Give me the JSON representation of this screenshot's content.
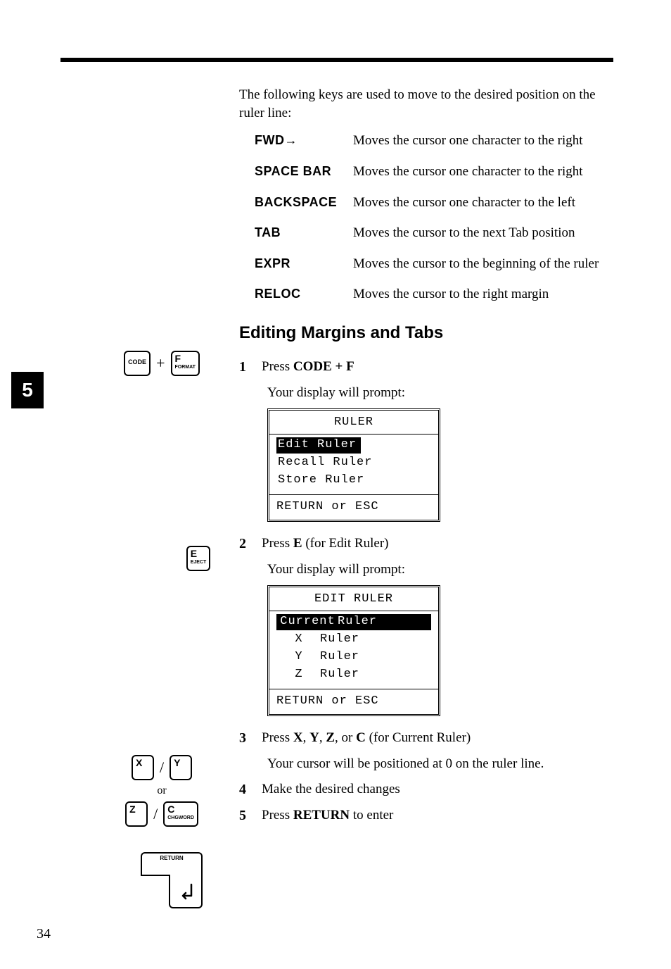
{
  "chapter_tab": "5",
  "page_number": "34",
  "intro": "The following keys are used to move to the desired position on the ruler line:",
  "keys": [
    {
      "name": "FWD→",
      "desc": "Moves the cursor one character to the right"
    },
    {
      "name": "SPACE BAR",
      "desc": "Moves the cursor one character to the right"
    },
    {
      "name": "BACKSPACE",
      "desc": "Moves the cursor one character to the left"
    },
    {
      "name": "TAB",
      "desc": "Moves the cursor to the next Tab position"
    },
    {
      "name": "EXPR",
      "desc": "Moves the cursor to the beginning of the ruler"
    },
    {
      "name": "RELOC",
      "desc": "Moves the cursor to the right margin"
    }
  ],
  "heading": "Editing Margins and Tabs",
  "step1": {
    "num": "1",
    "pre": "Press ",
    "bold": "CODE + F"
  },
  "prompt1": "Your display will prompt:",
  "screen1": {
    "title": "RULER",
    "selected": "Edit Ruler",
    "options": [
      "Recall Ruler",
      "Store Ruler"
    ],
    "footer": "RETURN or ESC"
  },
  "step2": {
    "num": "2",
    "pre": "Press ",
    "bold": "E",
    "post": " (for Edit Ruler)"
  },
  "prompt2": "Your display will prompt:",
  "screen2": {
    "title": "EDIT RULER",
    "selected_a": "Current",
    "selected_b": "Ruler",
    "rows": [
      {
        "a": "X",
        "b": "Ruler"
      },
      {
        "a": "Y",
        "b": "Ruler"
      },
      {
        "a": "Z",
        "b": "Ruler"
      }
    ],
    "footer": "RETURN or ESC"
  },
  "step3": {
    "num": "3",
    "pre": "Press ",
    "b1": "X",
    "s1": ", ",
    "b2": "Y",
    "s2": ", ",
    "b3": "Z",
    "s3": ", or ",
    "b4": "C",
    "post": " (for Current Ruler)"
  },
  "step3_body": "Your cursor will be positioned at 0 on the ruler line.",
  "step4": {
    "num": "4",
    "text": "Make the desired changes"
  },
  "step5": {
    "num": "5",
    "pre": "Press ",
    "bold": "RETURN",
    "post": " to enter"
  },
  "keycaps": {
    "code": "CODE",
    "f_main": "F",
    "f_sub": "FORMAT",
    "e_main": "E",
    "e_sub": "EJECT",
    "x": "X",
    "y": "Y",
    "z": "Z",
    "c_main": "C",
    "c_sub": "CHGWORD",
    "plus": "+",
    "slash": "/",
    "or": "or",
    "return": "RETURN"
  }
}
